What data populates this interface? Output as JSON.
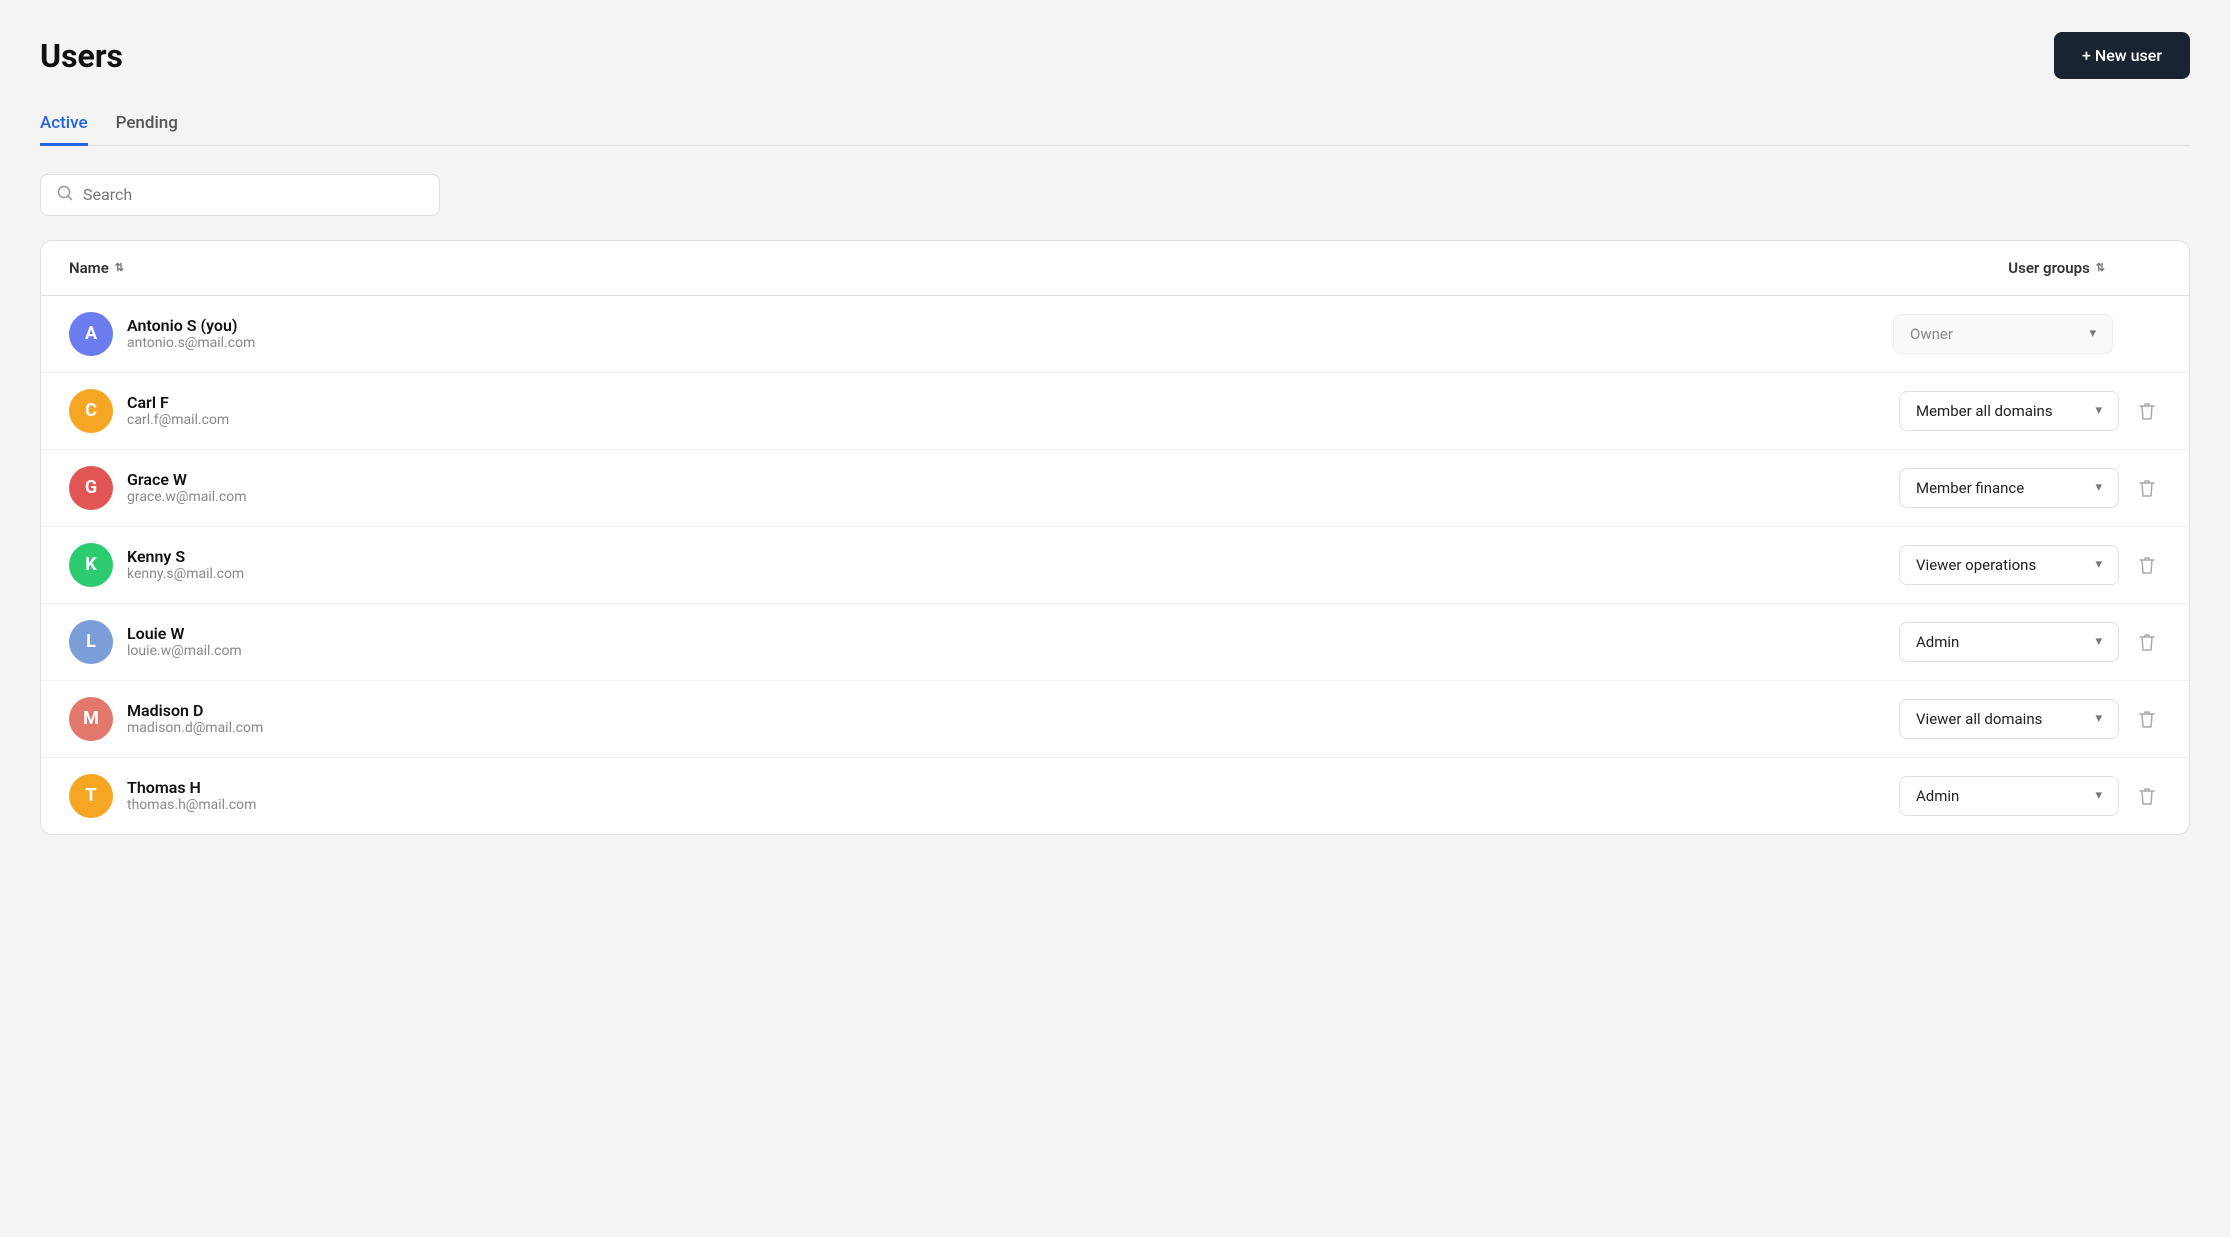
{
  "page": {
    "title": "Users",
    "new_user_label": "+ New user"
  },
  "tabs": [
    {
      "id": "active",
      "label": "Active",
      "active": true
    },
    {
      "id": "pending",
      "label": "Pending",
      "active": false
    }
  ],
  "search": {
    "placeholder": "Search"
  },
  "table": {
    "col_name": "Name",
    "col_user_groups": "User groups"
  },
  "users": [
    {
      "id": "antonio",
      "initials": "A",
      "avatar_color": "#6b7cef",
      "name": "Antonio S  (you)",
      "email": "antonio.s@mail.com",
      "role": "Owner",
      "is_owner": true,
      "show_delete": false
    },
    {
      "id": "carl",
      "initials": "C",
      "avatar_color": "#f5a623",
      "name": "Carl F",
      "email": "carl.f@mail.com",
      "role": "Member all domains",
      "is_owner": false,
      "show_delete": true
    },
    {
      "id": "grace",
      "initials": "G",
      "avatar_color": "#e25555",
      "name": "Grace W",
      "email": "grace.w@mail.com",
      "role": "Member finance",
      "is_owner": false,
      "show_delete": true
    },
    {
      "id": "kenny",
      "initials": "K",
      "avatar_color": "#2ecc71",
      "name": "Kenny S",
      "email": "kenny.s@mail.com",
      "role": "Viewer operations",
      "is_owner": false,
      "show_delete": true
    },
    {
      "id": "louie",
      "initials": "L",
      "avatar_color": "#7b9ed9",
      "name": "Louie W",
      "email": "louie.w@mail.com",
      "role": "Admin",
      "is_owner": false,
      "show_delete": true
    },
    {
      "id": "madison",
      "initials": "M",
      "avatar_color": "#e2786b",
      "name": "Madison D",
      "email": "madison.d@mail.com",
      "role": "Viewer all domains",
      "is_owner": false,
      "show_delete": true
    },
    {
      "id": "thomas",
      "initials": "T",
      "avatar_color": "#f5a623",
      "name": "Thomas H",
      "email": "thomas.h@mail.com",
      "role": "Admin",
      "is_owner": false,
      "show_delete": true
    }
  ]
}
